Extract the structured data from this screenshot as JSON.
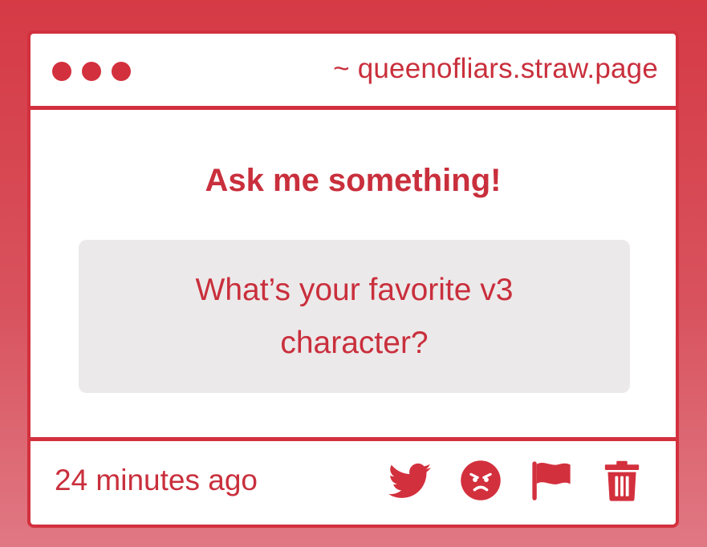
{
  "window": {
    "url": "~ queenofliars.straw.page"
  },
  "main": {
    "prompt": "Ask me something!",
    "question": "What’s your favorite v3 character?"
  },
  "footer": {
    "timestamp": "24 minutes ago",
    "actions": [
      {
        "name": "twitter-icon"
      },
      {
        "name": "angry-face-icon"
      },
      {
        "name": "flag-icon"
      },
      {
        "name": "trash-icon"
      }
    ]
  },
  "colors": {
    "accent": "#d3303d",
    "text": "#c92f3c",
    "question_bg": "#ece9ea"
  }
}
